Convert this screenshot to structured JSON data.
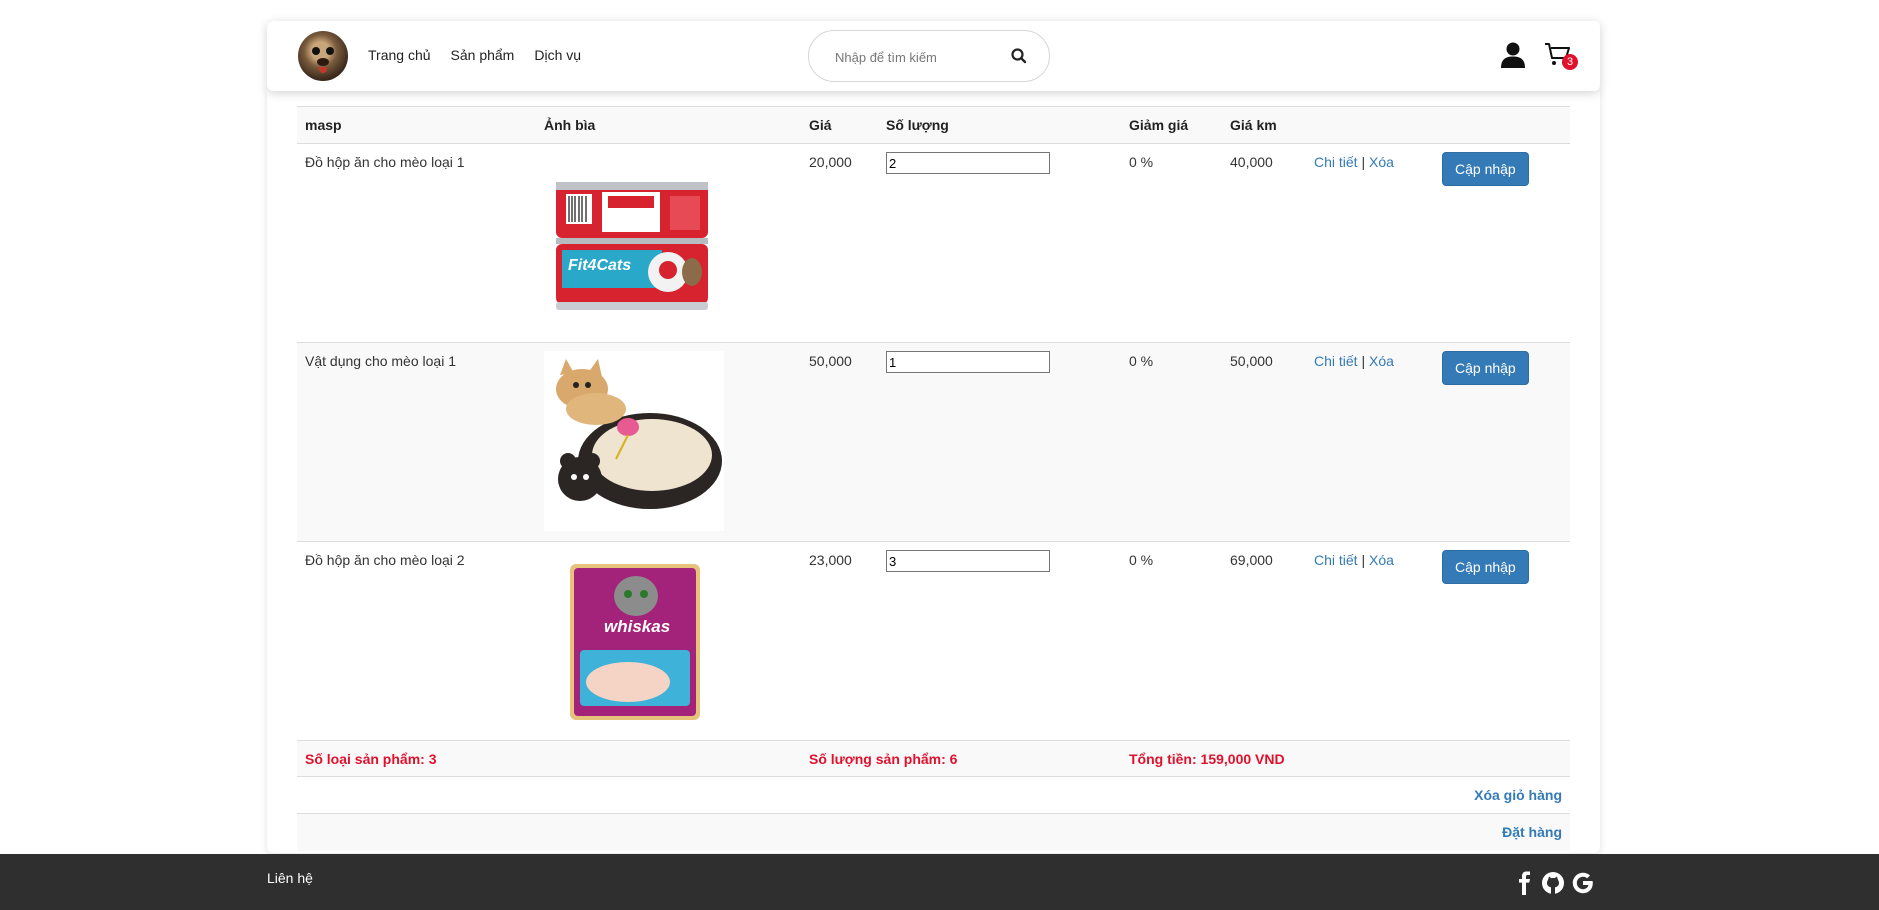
{
  "header": {
    "nav": [
      "Trang chủ",
      "Sản phẩm",
      "Dịch vụ"
    ],
    "search_placeholder": "Nhập để tìm kiếm",
    "cart_count": "3"
  },
  "table": {
    "headers": [
      "masp",
      "Ảnh bìa",
      "Giá",
      "Số lượng",
      "Giảm giá",
      "Giá km"
    ],
    "rows": [
      {
        "name": "Đồ hộp ăn cho mèo loại 1",
        "image": "canned-cat-food-image",
        "price": "20,000",
        "qty": "2",
        "discount": "0 %",
        "sale_price": "40,000",
        "detail": "Chi tiết",
        "sep": "|",
        "delete": "Xóa",
        "update": "Cập nhập"
      },
      {
        "name": "Vật dụng cho mèo loại 1",
        "image": "cat-scratcher-image",
        "price": "50,000",
        "qty": "1",
        "discount": "0 %",
        "sale_price": "50,000",
        "detail": "Chi tiết",
        "sep": "|",
        "delete": "Xóa",
        "update": "Cập nhập"
      },
      {
        "name": "Đồ hộp ăn cho mèo loại 2",
        "image": "whiskas-pouch-image",
        "price": "23,000",
        "qty": "3",
        "discount": "0 %",
        "sale_price": "69,000",
        "detail": "Chi tiết",
        "sep": "|",
        "delete": "Xóa",
        "update": "Cập nhập"
      }
    ],
    "summary": {
      "types": "Số loại sản phẩm: 3",
      "quantity": "Số lượng sản phẩm: 6",
      "total": "Tổng tiền: 159,000 VND"
    },
    "clear_cart": "Xóa giỏ hàng",
    "order": "Đặt hàng"
  },
  "footer": {
    "contact": "Liên hệ",
    "icons": [
      "facebook-icon",
      "github-icon",
      "google-icon"
    ]
  },
  "colors": {
    "accent": "#337ab7",
    "summary_red": "#e0112d",
    "footer_bg": "#2f2f2f"
  }
}
